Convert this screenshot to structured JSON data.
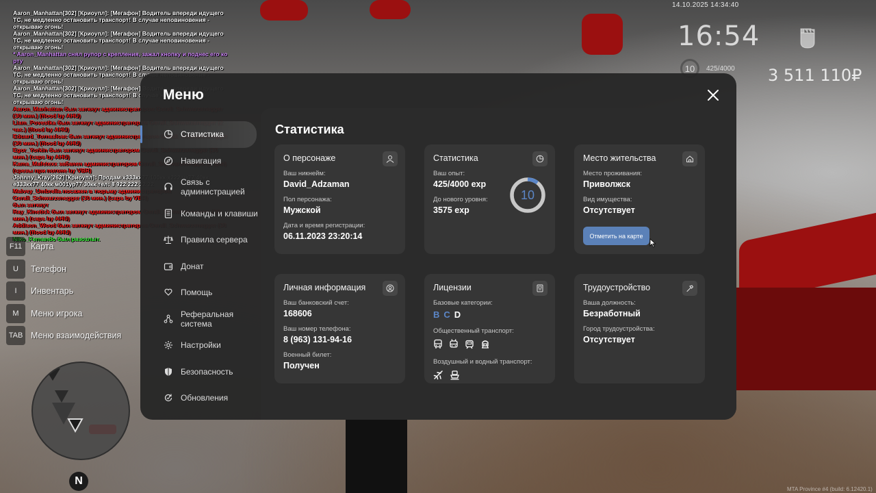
{
  "chat": [
    {
      "text": "Aaron_Manhattan[302] [Криоупл]: [Мегафон] Водитель впереди идущего ТС, не медленно остановить транспорт! В случае неповиновения - открываю огонь!",
      "color": "white"
    },
    {
      "text": "Aaron_Manhattan[302] [Криоупл]: [Мегафон] Водитель впереди идущего ТС, не медленно остановить транспорт! В случае неповиновения - открываю огонь!",
      "color": "white"
    },
    {
      "text": "* Aaron_Manhattan снял рупор с крепления, зажал кнопку и поднес его ко рту",
      "color": "violet"
    },
    {
      "text": "Aaron_Manhattan[302] [Криоупл]: [Мегафон] Водитель впереди идущего ТС, не медленно остановить транспорт! В случае неповиновения - открываю огонь!",
      "color": "white"
    },
    {
      "text": "Aaron_Manhattan[302] [Криоупл]: [Мегафон] Водитель впереди идущего ТС, не медленно остановить транспорт! В случае неповиновения - открываю огонь!",
      "color": "white"
    },
    {
      "text": "Aaron_Manhattan был заткнут администратором Gerall_Schwarzenegger (30 мин.) (flood by AHU)",
      "color": "red"
    },
    {
      "text": "Liam_Povestka был заткнут администратором Gerall_Schwarzenegger (2 час.) (flood by AHU)",
      "color": "red"
    },
    {
      "text": "Eduard_Tornasloac был заткнут администратором Gerall_Schwarzenegger (30 мин.) (flood by AHU)",
      "color": "red"
    },
    {
      "text": "Egor_Yorkin был заткнут администратором Gerall_Schwarzenegger (30 мин.) (caps by AHU)",
      "color": "red"
    },
    {
      "text": "Kama_Mafetexx забанен администратором Gerall_Schwarzenegger (3 дня) (срезы при погоне by VBR)",
      "color": "red"
    },
    {
      "text": "Johnny_Kray[262] [Криоупл]: Продам х333кх77 100кк х222ам77 40кк е333кх77 40кк м001ур77 30кк тел: 8 922 222 22 22",
      "color": "white"
    },
    {
      "text": "Malvey_Umbrella посажен в тюрьму администратором Gerall_Schwarzenegger (30 мин.) (caps by VBR)",
      "color": "red"
    },
    {
      "text": "был заткнут",
      "color": "red"
    },
    {
      "text": "Ray_Kinetick был заткнут администратором Gerall_Schwarzenegger (30 мин.) (caps by AHU)",
      "color": "red"
    },
    {
      "text": "Addison_Wood был заткнут администратором Gerall_Schwarzenegger (30 мин.) (flood by AHU)",
      "color": "red"
    },
    {
      "text": "Niko_Fernando был разозлыт.",
      "color": "green"
    }
  ],
  "hud": {
    "datetime": "14.10.2025 14:34:40",
    "clock": "16:54",
    "level": "10",
    "exp": "425/4000",
    "money": "3 511 110₽"
  },
  "hotkeys": [
    {
      "key": "F11",
      "label": "Карта"
    },
    {
      "key": "U",
      "label": "Телефон"
    },
    {
      "key": "I",
      "label": "Инвентарь"
    },
    {
      "key": "M",
      "label": "Меню игрока"
    },
    {
      "key": "TAB",
      "label": "Меню взаимодействия"
    }
  ],
  "minimap": {
    "north_label": "N"
  },
  "version": "MTA Province #4 (build: 6.12420.1)",
  "menu": {
    "title": "Меню",
    "nav": [
      {
        "label": "Статистика",
        "icon": "stats-icon",
        "active": true
      },
      {
        "label": "Навигация",
        "icon": "compass-icon"
      },
      {
        "label": "Связь с администрацией",
        "icon": "headset-icon"
      },
      {
        "label": "Команды и клавиши",
        "icon": "document-icon"
      },
      {
        "label": "Правила сервера",
        "icon": "scales-icon"
      },
      {
        "label": "Донат",
        "icon": "wallet-icon"
      },
      {
        "label": "Помощь",
        "icon": "heart-hands-icon"
      },
      {
        "label": "Реферальная система",
        "icon": "network-icon"
      },
      {
        "label": "Настройки",
        "icon": "gear-icon"
      },
      {
        "label": "Безопасность",
        "icon": "shield-icon"
      },
      {
        "label": "Обновления",
        "icon": "refresh-icon"
      }
    ],
    "content_title": "Статистика",
    "cards": {
      "character": {
        "title": "О персонаже",
        "icon": "user-icon",
        "fields": [
          {
            "label": "Ваш никнейм:",
            "value": "David_Adzaman"
          },
          {
            "label": "Пол персонажа:",
            "value": "Мужской"
          },
          {
            "label": "Дата и время регистрации:",
            "value": "06.11.2023 23:20:14"
          }
        ]
      },
      "stats": {
        "title": "Статистика",
        "icon": "pie-chart-icon",
        "fields": [
          {
            "label": "Ваш опыт:",
            "value": "425/4000 exp"
          },
          {
            "label": "До нового уровня:",
            "value": "3575 exp"
          }
        ],
        "level": "10",
        "progress": 0.106
      },
      "residence": {
        "title": "Место жительства",
        "icon": "home-icon",
        "fields": [
          {
            "label": "Место проживания:",
            "value": "Приволжск"
          },
          {
            "label": "Вид имущества:",
            "value": "Отсутствует"
          }
        ],
        "button": "Отметить на карте"
      },
      "personal": {
        "title": "Личная информация",
        "icon": "person-circle-icon",
        "fields": [
          {
            "label": "Ваш банковский счет:",
            "value": "168606"
          },
          {
            "label": "Ваш номер телефона:",
            "value": "8 (963) 131-94-16"
          },
          {
            "label": "Военный билет:",
            "value": "Получен"
          }
        ]
      },
      "licenses": {
        "title": "Лицензии",
        "icon": "id-card-icon",
        "basic_label": "Базовые категории:",
        "categories": [
          {
            "name": "B",
            "color": "#5b86c7"
          },
          {
            "name": "C",
            "color": "#5b86c7"
          },
          {
            "name": "D",
            "color": "#ffffff"
          }
        ],
        "public_label": "Общественный транспорт:",
        "public_icons": [
          "bus-icon",
          "trolleybus-icon",
          "tram-icon",
          "train-icon"
        ],
        "air_label": "Воздушный и водный транспорт:",
        "air_icons": [
          "plane-icon",
          "boat-icon"
        ]
      },
      "job": {
        "title": "Трудоустройство",
        "icon": "hammer-icon",
        "fields": [
          {
            "label": "Ваша должность:",
            "value": "Безработный"
          },
          {
            "label": "Город трудоустройства:",
            "value": "Отсутствует"
          }
        ]
      }
    }
  },
  "colors": {
    "accent": "#5b86c7",
    "panel": "#2b2b2b",
    "card": "#363636"
  }
}
